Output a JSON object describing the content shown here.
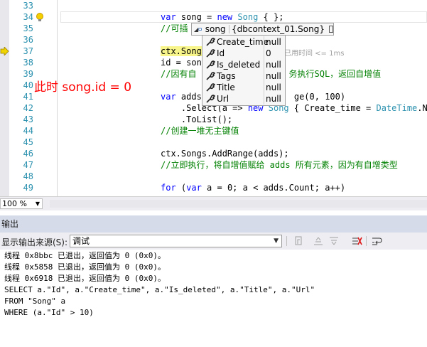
{
  "editor": {
    "line_numbers": [
      "33",
      "34",
      "35",
      "36",
      "37",
      "38",
      "39",
      "40",
      "41",
      "42",
      "43",
      "44",
      "45",
      "46",
      "47",
      "48",
      "49"
    ],
    "lines": [
      {
        "parts": []
      },
      {
        "parts": [
          {
            "c": "kw",
            "t": "var"
          },
          {
            "c": "",
            "t": " song = "
          },
          {
            "c": "kw",
            "t": "new"
          },
          {
            "c": "",
            "t": " "
          },
          {
            "c": "type",
            "t": "Song"
          },
          {
            "c": "",
            "t": " { };"
          }
        ]
      },
      {
        "parts": [
          {
            "c": "cmt",
            "t": "//可插"
          }
        ]
      },
      {
        "parts": []
      },
      {
        "parts": [
          {
            "c": "hl",
            "t": "ctx.Songs"
          }
        ]
      },
      {
        "parts": [
          {
            "c": "",
            "t": "id = sons"
          }
        ]
      },
      {
        "parts": [
          {
            "c": "cmt",
            "t": "//因有自"
          },
          {
            "c": "cmt",
            "t": "                  务执行SQL，返回自增值"
          }
        ]
      },
      {
        "parts": []
      },
      {
        "parts": [
          {
            "c": "kw",
            "t": "var"
          },
          {
            "c": "",
            "t": " adds"
          },
          {
            "c": "",
            "t": "                  ge(0, 100)"
          }
        ]
      },
      {
        "parts": [
          {
            "c": "",
            "t": "    .Select(a => "
          },
          {
            "c": "kw",
            "t": "new"
          },
          {
            "c": "",
            "t": " "
          },
          {
            "c": "type",
            "t": "Song"
          },
          {
            "c": "",
            "t": " { Create_time = "
          },
          {
            "c": "type",
            "t": "DateTime"
          },
          {
            "c": "",
            "t": ".Now"
          }
        ]
      },
      {
        "parts": [
          {
            "c": "",
            "t": "    .ToList();"
          }
        ]
      },
      {
        "parts": [
          {
            "c": "cmt",
            "t": "//创建一堆无主键值"
          }
        ]
      },
      {
        "parts": []
      },
      {
        "parts": [
          {
            "c": "",
            "t": "ctx.Songs.AddRange(adds);"
          }
        ]
      },
      {
        "parts": [
          {
            "c": "cmt",
            "t": "//立即执行，将自增值赋给 adds 所有元素，因为有自增类型"
          }
        ]
      },
      {
        "parts": []
      },
      {
        "parts": [
          {
            "c": "kw",
            "t": "for"
          },
          {
            "c": "",
            "t": " ("
          },
          {
            "c": "kw",
            "t": "var"
          },
          {
            "c": "",
            "t": " a = 0; a < adds.Count; a++)"
          }
        ]
      }
    ],
    "annotation": "此时 song.id = 0",
    "perf_tip": "已用时间 <= 1ms"
  },
  "datatip": {
    "name": "song",
    "value": "{dbcontext_01.Song}",
    "props": [
      {
        "name": "Create_time",
        "value": "null"
      },
      {
        "name": "Id",
        "value": "0"
      },
      {
        "name": "Is_deleted",
        "value": "null"
      },
      {
        "name": "Tags",
        "value": "null"
      },
      {
        "name": "Title",
        "value": "null"
      },
      {
        "name": "Url",
        "value": "null"
      }
    ]
  },
  "zoom": {
    "value": "100 %"
  },
  "output": {
    "title": "输出",
    "source_label": "显示输出来源(S):",
    "source_value": "调试",
    "lines": [
      "线程 0x8bbc 已退出，返回值为 0 (0x0)。",
      "线程 0x5858 已退出，返回值为 0 (0x0)。",
      "线程 0x6918 已退出，返回值为 0 (0x0)。",
      "SELECT a.\"Id\", a.\"Create_time\", a.\"Is_deleted\", a.\"Title\", a.\"Url\"",
      "FROM \"Song\" a",
      "WHERE (a.\"Id\" > 10)"
    ]
  },
  "colors": {
    "keyword": "#0000ff",
    "type": "#2b91af",
    "comment": "#008000",
    "annotation": "#ff0000",
    "line_number": "#2b91af"
  }
}
